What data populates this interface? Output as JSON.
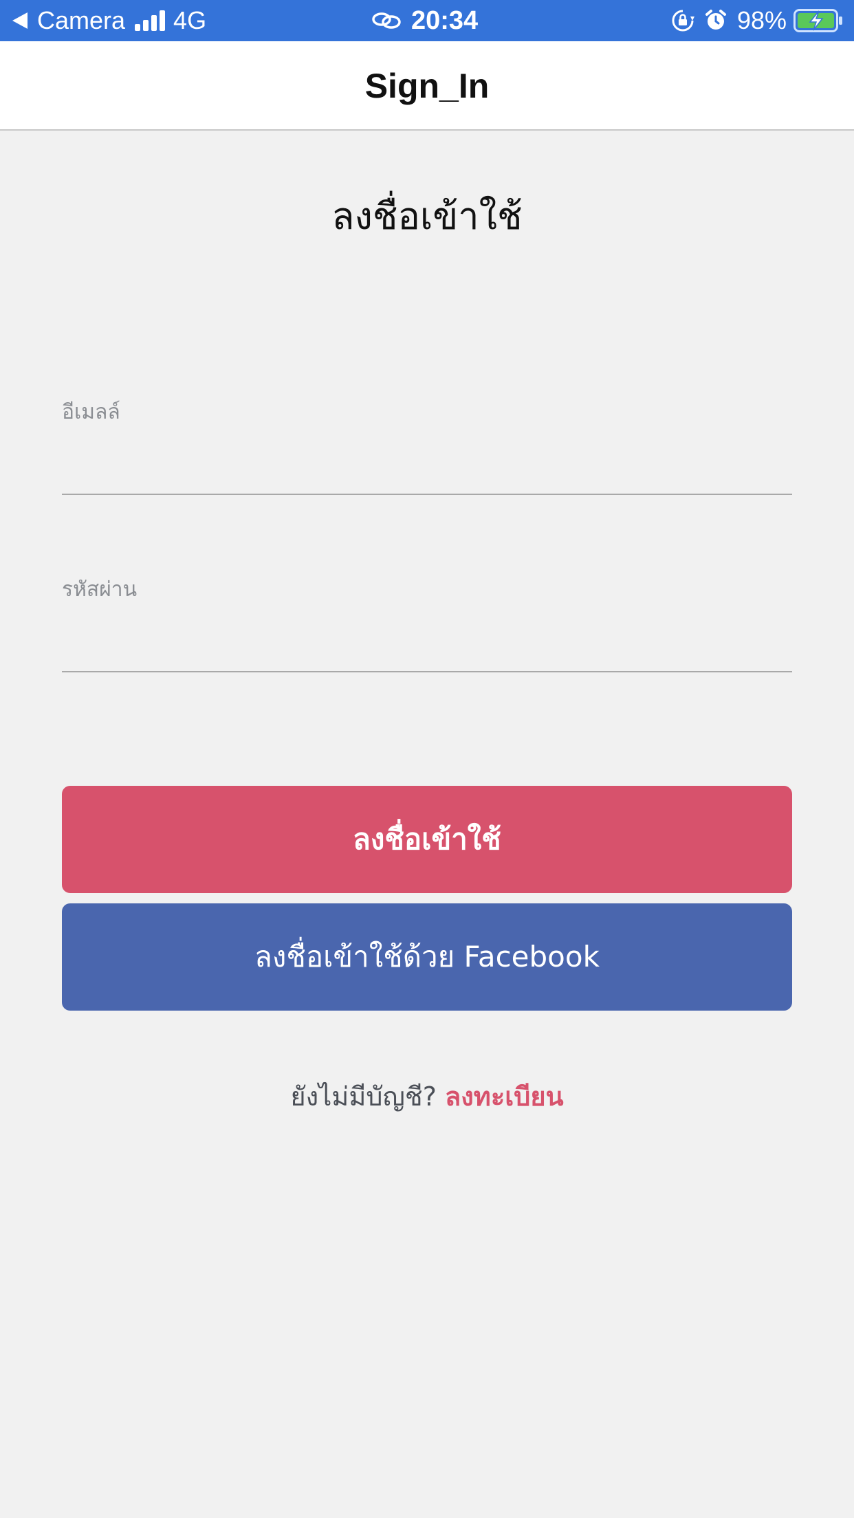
{
  "status_bar": {
    "back_app": "Camera",
    "network": "4G",
    "time": "20:34",
    "battery": "98%",
    "background_color": "#3473d9",
    "battery_color": "#5ac85a"
  },
  "nav": {
    "title": "Sign_In"
  },
  "page": {
    "heading": "ลงชื่อเข้าใช้"
  },
  "form": {
    "email_label": "อีเมลล์",
    "email_value": "",
    "password_label": "รหัสผ่าน",
    "password_value": ""
  },
  "buttons": {
    "signin_label": "ลงชื่อเข้าใช้",
    "signin_color": "#d7526c",
    "facebook_label": "ลงชื่อเข้าใช้ด้วย Facebook",
    "facebook_color": "#4a66ae"
  },
  "signup": {
    "prompt": "ยังไม่มีบัญชี?",
    "link_label": "ลงทะเบียน"
  }
}
